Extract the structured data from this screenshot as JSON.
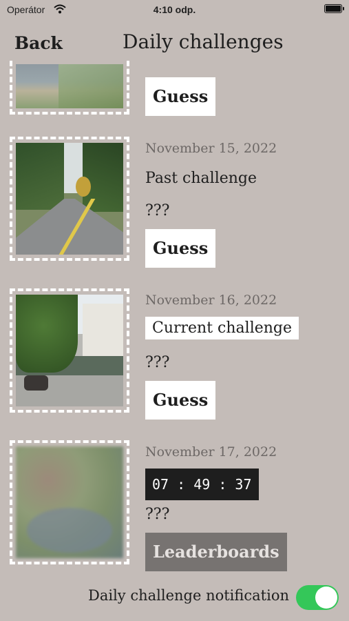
{
  "status": {
    "carrier": "Operátor",
    "time": "4:10 odp."
  },
  "nav": {
    "back_label": "Back",
    "title": "Daily challenges"
  },
  "cards": [
    {
      "button": "Guess"
    },
    {
      "date": "November 15, 2022",
      "subtitle": "Past challenge",
      "result": "???",
      "button": "Guess"
    },
    {
      "date": "November 16, 2022",
      "subtitle": "Current challenge",
      "result": "???",
      "button": "Guess"
    },
    {
      "date": "November 17, 2022",
      "timer": "07 : 49 : 37",
      "result": "???",
      "button": "Leaderboards"
    }
  ],
  "notification": {
    "label": "Daily challenge notification",
    "enabled": true
  },
  "colors": {
    "background": "#c4bcb8",
    "toggle_on": "#34c759",
    "date_text": "#6d6866"
  }
}
